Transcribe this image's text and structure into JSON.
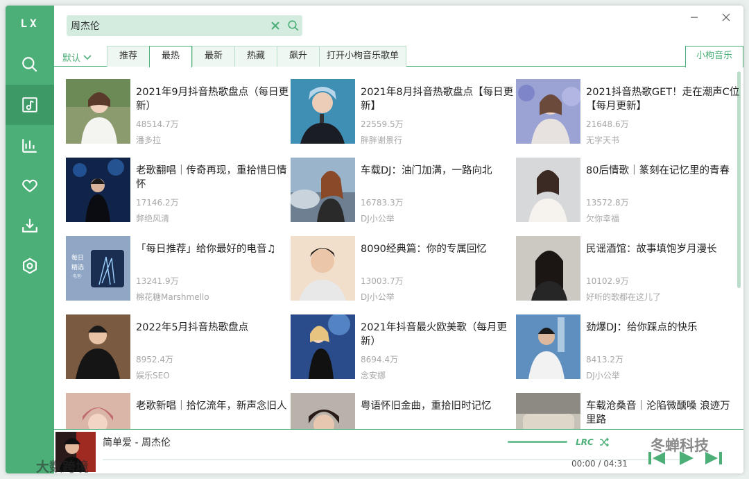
{
  "app": {
    "logo": "LX"
  },
  "colors": {
    "accent": "#4caf78",
    "accent_dark": "#3d9a67",
    "search_bg": "#d4ecdf",
    "muted_text": "#a7a7a7"
  },
  "sidebar": {
    "items": [
      {
        "name": "search",
        "icon": "search-icon"
      },
      {
        "name": "songlist",
        "icon": "music-note-icon",
        "active": true
      },
      {
        "name": "leaderboard",
        "icon": "bar-chart-icon"
      },
      {
        "name": "favorites",
        "icon": "heart-icon"
      },
      {
        "name": "download",
        "icon": "download-icon"
      },
      {
        "name": "settings",
        "icon": "settings-icon"
      }
    ]
  },
  "search": {
    "value": "周杰伦",
    "placeholder": ""
  },
  "sort": {
    "selected": "默认"
  },
  "tabs": [
    {
      "label": "推荐"
    },
    {
      "label": "最热",
      "active": true
    },
    {
      "label": "最新"
    },
    {
      "label": "热藏"
    },
    {
      "label": "飙升"
    },
    {
      "label": "打开小枸音乐歌单"
    }
  ],
  "source_tab": {
    "label": "小枸音乐"
  },
  "playlists": [
    {
      "title": "2021年9月抖音热歌盘点（每日更新）",
      "plays": "48514.7万",
      "author": "潘多拉"
    },
    {
      "title": "2021年8月抖音热歌盘点【每日更新】",
      "plays": "22559.5万",
      "author": "胖胖谢景行"
    },
    {
      "title": "2021抖音热歌GET！走在潮声C位【每月更新】",
      "plays": "21648.6万",
      "author": "无字天书"
    },
    {
      "title": "老歌翻唱｜传奇再现，重拾惜日情怀",
      "plays": "17146.2万",
      "author": "弊绝风清"
    },
    {
      "title": "车载DJ：油门加满，一路向北",
      "plays": "16783.3万",
      "author": "DJ小公举"
    },
    {
      "title": "80后情歌｜篆刻在记忆里的青春",
      "plays": "13572.8万",
      "author": "欠你幸福"
    },
    {
      "title": "「每日推荐」给你最好的电音♫",
      "plays": "13241.9万",
      "author": "棉花糖Marshmello",
      "cover_text": [
        "每日",
        "精选",
        "·电音·"
      ]
    },
    {
      "title": "8090经典篇：你的专属回忆",
      "plays": "13003.7万",
      "author": "DJ小公举"
    },
    {
      "title": "民谣酒馆：故事填饱岁月漫长",
      "plays": "10102.9万",
      "author": "好听的歌都在这儿了"
    },
    {
      "title": "2022年5月抖音热歌盘点",
      "plays": "8952.4万",
      "author": "娱乐SEO"
    },
    {
      "title": "2021年抖音最火欧美歌（每月更新）",
      "plays": "8694.4万",
      "author": "念安娜"
    },
    {
      "title": "劲爆DJ：给你踩点的快乐",
      "plays": "8413.2万",
      "author": "DJ小公举"
    },
    {
      "title": "老歌新唱｜拾忆流年，新声念旧人",
      "plays": "",
      "author": ""
    },
    {
      "title": "粤语怀旧金曲，重拾旧时记忆",
      "plays": "",
      "author": ""
    },
    {
      "title": "车载沧桑音｜沦陷微醺嗓 浪迹万里路",
      "plays": "",
      "author": ""
    }
  ],
  "player": {
    "title": "简单爱 - 周杰伦",
    "lrc_label": "LRC",
    "time": "00:00 / 04:31",
    "volume": 1.0,
    "progress": 0
  },
  "watermarks": {
    "left": "大数跨境",
    "right": "冬蝉科技"
  }
}
